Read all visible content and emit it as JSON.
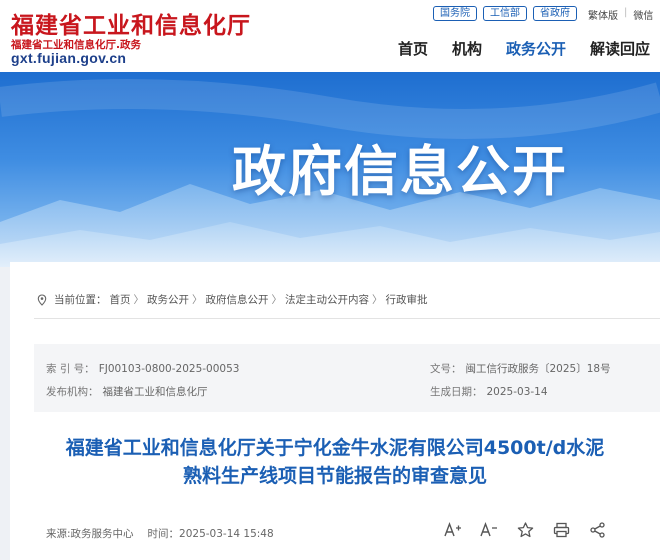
{
  "header": {
    "logo_cn": "福建省工业和信息化厅",
    "logo_sub": "福建省工业和信息化厅.政务",
    "logo_url": "gxt.fujian.gov.cn",
    "pills": [
      "国务院",
      "工信部",
      "省政府"
    ],
    "top_links": [
      "繁体版",
      "微信"
    ],
    "nav": [
      {
        "label": "首页",
        "active": false
      },
      {
        "label": "机构",
        "active": false
      },
      {
        "label": "政务公开",
        "active": true
      },
      {
        "label": "解读回应",
        "active": false
      }
    ]
  },
  "banner": {
    "title": "政府信息公开"
  },
  "breadcrumb": {
    "prefix": "当前位置：",
    "items": [
      "首页",
      "政务公开",
      "政府信息公开",
      "法定主动公开内容",
      "行政审批"
    ]
  },
  "meta": {
    "index_label": "索 引 号：",
    "index_value": "FJ00103-0800-2025-00053",
    "docno_label": "文号：",
    "docno_value": "闽工信行政服务〔2025〕18号",
    "org_label": "发布机构：",
    "org_value": "福建省工业和信息化厅",
    "date_label": "生成日期：",
    "date_value": "2025-03-14"
  },
  "article": {
    "title_line1": "福建省工业和信息化厅关于宁化金牛水泥有限公司4500t/d水泥",
    "title_line2": "熟料生产线项目节能报告的审查意见",
    "source": "来源:政务服务中心",
    "time_label": "时间：",
    "time_value": "2025-03-14 15:48"
  },
  "tools": [
    "font-increase-icon",
    "font-decrease-icon",
    "star-icon",
    "print-icon",
    "share-icon"
  ],
  "colors": {
    "brand_red": "#c8161d",
    "brand_blue": "#1b5fb4"
  }
}
